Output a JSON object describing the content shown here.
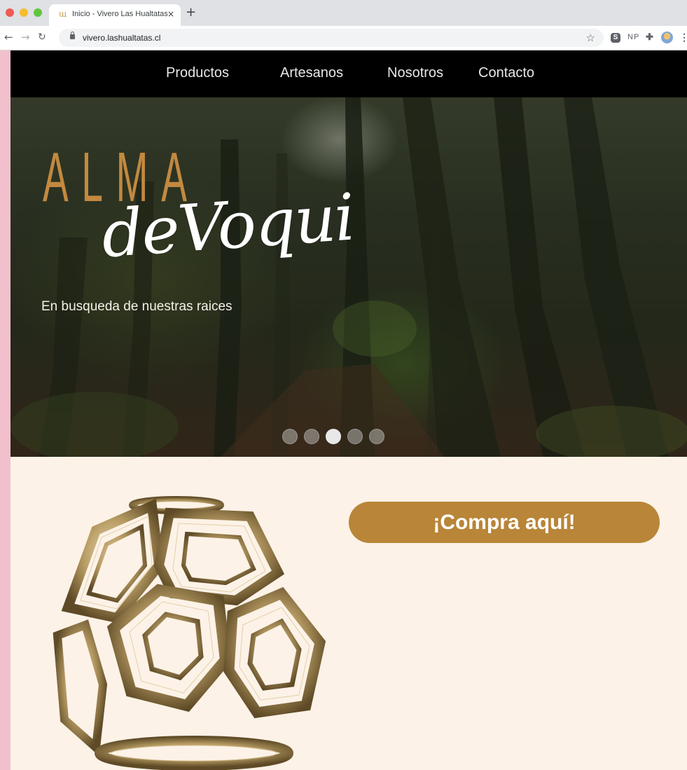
{
  "browser": {
    "tab_title": "Inicio - Vivero Las Hualtatas",
    "tab_close": "×",
    "new_tab": "+",
    "url": "vivero.lashualtatas.cl",
    "extensions": [
      "S",
      "NP"
    ]
  },
  "nav": {
    "items": [
      "Productos",
      "Artesanos",
      "Nosotros",
      "Contacto"
    ]
  },
  "hero": {
    "logo_alma": "ALMA",
    "logo_script": "deVoqui",
    "tagline": "En busqueda de nuestras raices",
    "slide_count": 5,
    "active_slide": 3
  },
  "cta": {
    "label": "¡Compra aquí!"
  },
  "colors": {
    "brand_gold": "#b98538",
    "nav_background": "#000000",
    "page_background": "#fcf2e7",
    "outer_background": "#f2c0cc"
  },
  "icons": [
    "back-arrow-icon",
    "forward-arrow-icon",
    "reload-icon",
    "lock-icon",
    "star-icon",
    "puzzle-icon",
    "profile-avatar-icon",
    "menu-dots-icon"
  ]
}
